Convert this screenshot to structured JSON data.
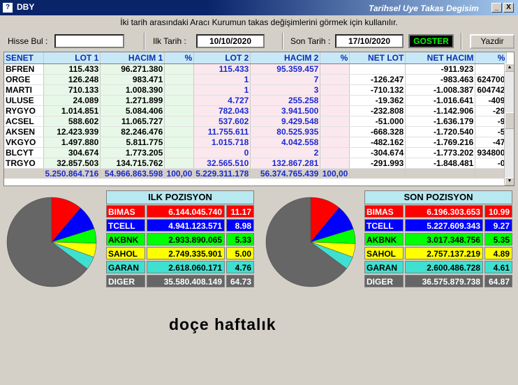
{
  "window": {
    "icon": "?",
    "title": "DBY",
    "subtitle": "Tarihsel Uye Takas Degisim",
    "minimize": "_",
    "close": "X"
  },
  "info_text": "İki tarih arasındaki  Aracı Kurumun takas değişimlerini görmek için kullanılır.",
  "search": {
    "label": "Hisse Bul :",
    "value": ""
  },
  "start_date": {
    "label": "Ilk Tarih :",
    "value": "10/10/2020"
  },
  "end_date": {
    "label": "Son Tarih :",
    "value": "17/10/2020"
  },
  "buttons": {
    "show": "GOSTER",
    "print": "Yazdir"
  },
  "grid": {
    "headers": [
      "SENET",
      "LOT 1",
      "HACIM 1",
      "%",
      "LOT 2",
      "HACIM 2",
      "%",
      "NET LOT",
      "NET HACIM",
      "%"
    ],
    "rows": [
      [
        "BFREN",
        "115.433",
        "96.271.380",
        "",
        "115.433",
        "95.359.457",
        "",
        "",
        "-911.923",
        ""
      ],
      [
        "ORGE",
        "126.248",
        "983.471",
        "",
        "1",
        "7",
        "",
        "-126.247",
        "-983.463",
        "624700"
      ],
      [
        "MARTI",
        "710.133",
        "1.008.390",
        "",
        "1",
        "3",
        "",
        "-710.132",
        "-1.008.387",
        "604742"
      ],
      [
        "ULUSE",
        "24.089",
        "1.271.899",
        "",
        "4.727",
        "255.258",
        "",
        "-19.362",
        "-1.016.641",
        "-409"
      ],
      [
        "RYGYO",
        "1.014.851",
        "5.084.406",
        "",
        "782.043",
        "3.941.500",
        "",
        "-232.808",
        "-1.142.906",
        "-29"
      ],
      [
        "ACSEL",
        "588.602",
        "11.065.727",
        "",
        "537.602",
        "9.429.548",
        "",
        "-51.000",
        "-1.636.179",
        "-9"
      ],
      [
        "AKSEN",
        "12.423.939",
        "82.246.476",
        "",
        "11.755.611",
        "80.525.935",
        "",
        "-668.328",
        "-1.720.540",
        "-5"
      ],
      [
        "VKGYO",
        "1.497.880",
        "5.811.775",
        "",
        "1.015.718",
        "4.042.558",
        "",
        "-482.162",
        "-1.769.216",
        "-47"
      ],
      [
        "BLCYT",
        "304.674",
        "1.773.205",
        "",
        "0",
        "2",
        "",
        "-304.674",
        "-1.773.202",
        "934800"
      ],
      [
        "TRGYO",
        "32.857.503",
        "134.715.762",
        "",
        "32.565.510",
        "132.867.281",
        "",
        "-291.993",
        "-1.848.481",
        "-0"
      ]
    ],
    "totals": [
      "",
      "5.250.864.716",
      "54.966.863.598",
      "100,00",
      "5.229.311.178",
      "56.374.765.439",
      "100,00",
      "",
      "",
      ""
    ]
  },
  "ilk_pozisyon": {
    "title": "ILK POZISYON",
    "rows": [
      {
        "name": "BIMAS",
        "value": "6.144.045.740",
        "pct": "11.17",
        "pct_num": 11.17,
        "color": "#ff0000",
        "text": "#ffffff"
      },
      {
        "name": "TCELL",
        "value": "4.941.123.571",
        "pct": "8.98",
        "pct_num": 8.98,
        "color": "#0000ff",
        "text": "#ffffff"
      },
      {
        "name": "AKBNK",
        "value": "2.933.890.065",
        "pct": "5.33",
        "pct_num": 5.33,
        "color": "#00ff00",
        "text": "#000000"
      },
      {
        "name": "SAHOL",
        "value": "2.749.335.901",
        "pct": "5.00",
        "pct_num": 5.0,
        "color": "#ffff00",
        "text": "#000000"
      },
      {
        "name": "GARAN",
        "value": "2.618.060.171",
        "pct": "4.76",
        "pct_num": 4.76,
        "color": "#40e0d0",
        "text": "#000000"
      },
      {
        "name": "DIGER",
        "value": "35.580.408.149",
        "pct": "64.73",
        "pct_num": 64.73,
        "color": "#666666",
        "text": "#ffffff"
      }
    ]
  },
  "son_pozisyon": {
    "title": "SON POZISYON",
    "rows": [
      {
        "name": "BIMAS",
        "value": "6.196.303.653",
        "pct": "10.99",
        "pct_num": 10.99,
        "color": "#ff0000",
        "text": "#ffffff"
      },
      {
        "name": "TCELL",
        "value": "5.227.609.343",
        "pct": "9.27",
        "pct_num": 9.27,
        "color": "#0000ff",
        "text": "#ffffff"
      },
      {
        "name": "AKBNK",
        "value": "3.017.348.756",
        "pct": "5.35",
        "pct_num": 5.35,
        "color": "#00ff00",
        "text": "#000000"
      },
      {
        "name": "SAHOL",
        "value": "2.757.137.219",
        "pct": "4.89",
        "pct_num": 4.89,
        "color": "#ffff00",
        "text": "#000000"
      },
      {
        "name": "GARAN",
        "value": "2.600.486.728",
        "pct": "4.61",
        "pct_num": 4.61,
        "color": "#40e0d0",
        "text": "#000000"
      },
      {
        "name": "DIGER",
        "value": "36.575.879.738",
        "pct": "64.87",
        "pct_num": 64.87,
        "color": "#666666",
        "text": "#ffffff"
      }
    ]
  },
  "overlay_text": "doçe haftalık"
}
